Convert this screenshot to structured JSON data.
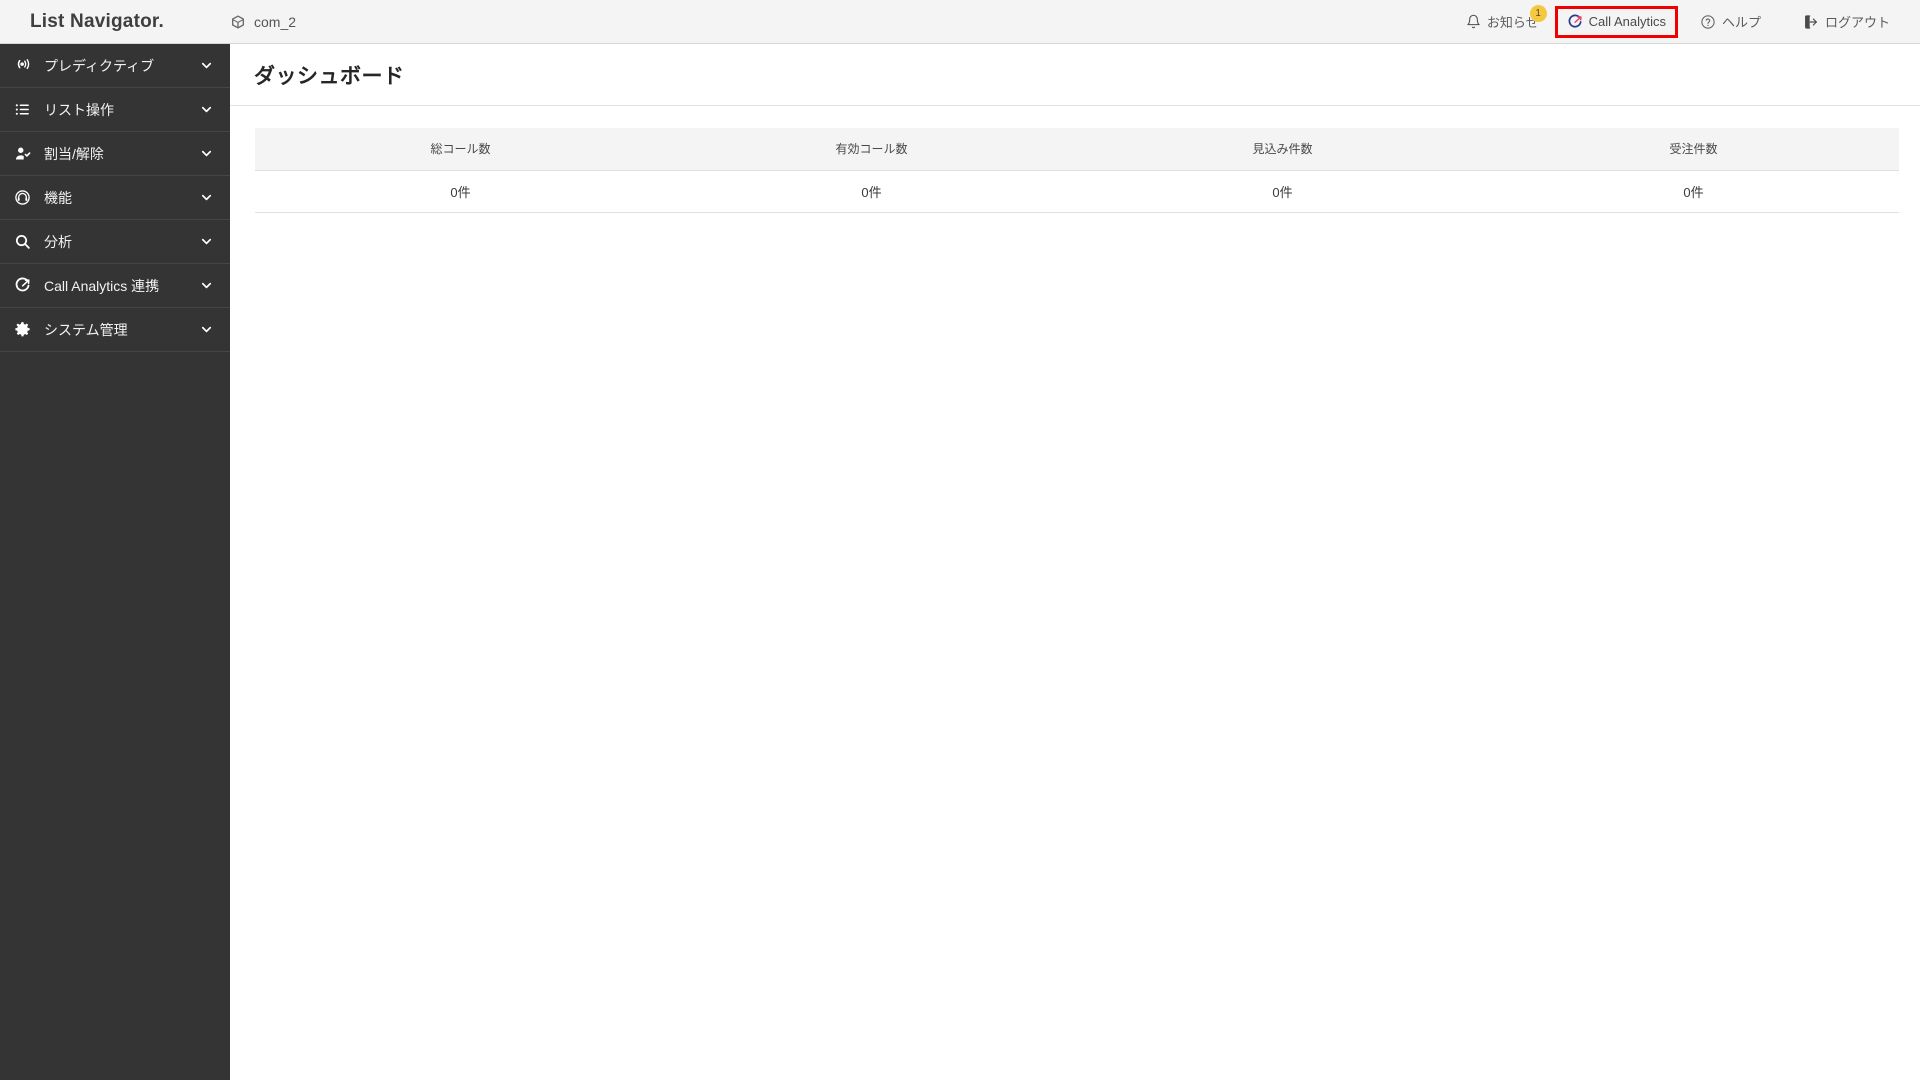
{
  "header": {
    "brand": "List Navigator.",
    "tenant": {
      "icon": "cube-icon",
      "label": "com_2"
    },
    "right_items": [
      {
        "key": "notice",
        "icon": "bell-icon",
        "label": "お知らせ",
        "badge": "1"
      },
      {
        "key": "analytics",
        "icon": "call-analytics-icon",
        "label": "Call Analytics"
      },
      {
        "key": "help",
        "icon": "question-circle-icon",
        "label": "ヘルプ"
      },
      {
        "key": "logout",
        "icon": "logout-icon",
        "label": "ログアウト"
      }
    ],
    "highlight_color": "#f00000",
    "badge_color": "#f5c842"
  },
  "sidebar": {
    "background": "#343434",
    "items": [
      {
        "icon": "broadcast-icon",
        "label": "プレディクティブ",
        "chevron": "chevron-down-icon"
      },
      {
        "icon": "list-icon",
        "label": "リスト操作",
        "chevron": "chevron-down-icon"
      },
      {
        "icon": "user-check-icon",
        "label": "割当/解除",
        "chevron": "chevron-down-icon"
      },
      {
        "icon": "headset-icon",
        "label": "機能",
        "chevron": "chevron-down-icon"
      },
      {
        "icon": "search-icon",
        "label": "分析",
        "chevron": "chevron-down-icon"
      },
      {
        "icon": "call-analytics-icon",
        "label": "Call Analytics 連携",
        "chevron": "chevron-down-icon"
      },
      {
        "icon": "gear-icon",
        "label": "システム管理",
        "chevron": "chevron-down-icon"
      }
    ]
  },
  "main": {
    "page_title": "ダッシュボード",
    "table": {
      "columns": [
        "総コール数",
        "有効コール数",
        "見込み件数",
        "受注件数"
      ],
      "rows": [
        [
          "0件",
          "0件",
          "0件",
          "0件"
        ]
      ]
    }
  }
}
